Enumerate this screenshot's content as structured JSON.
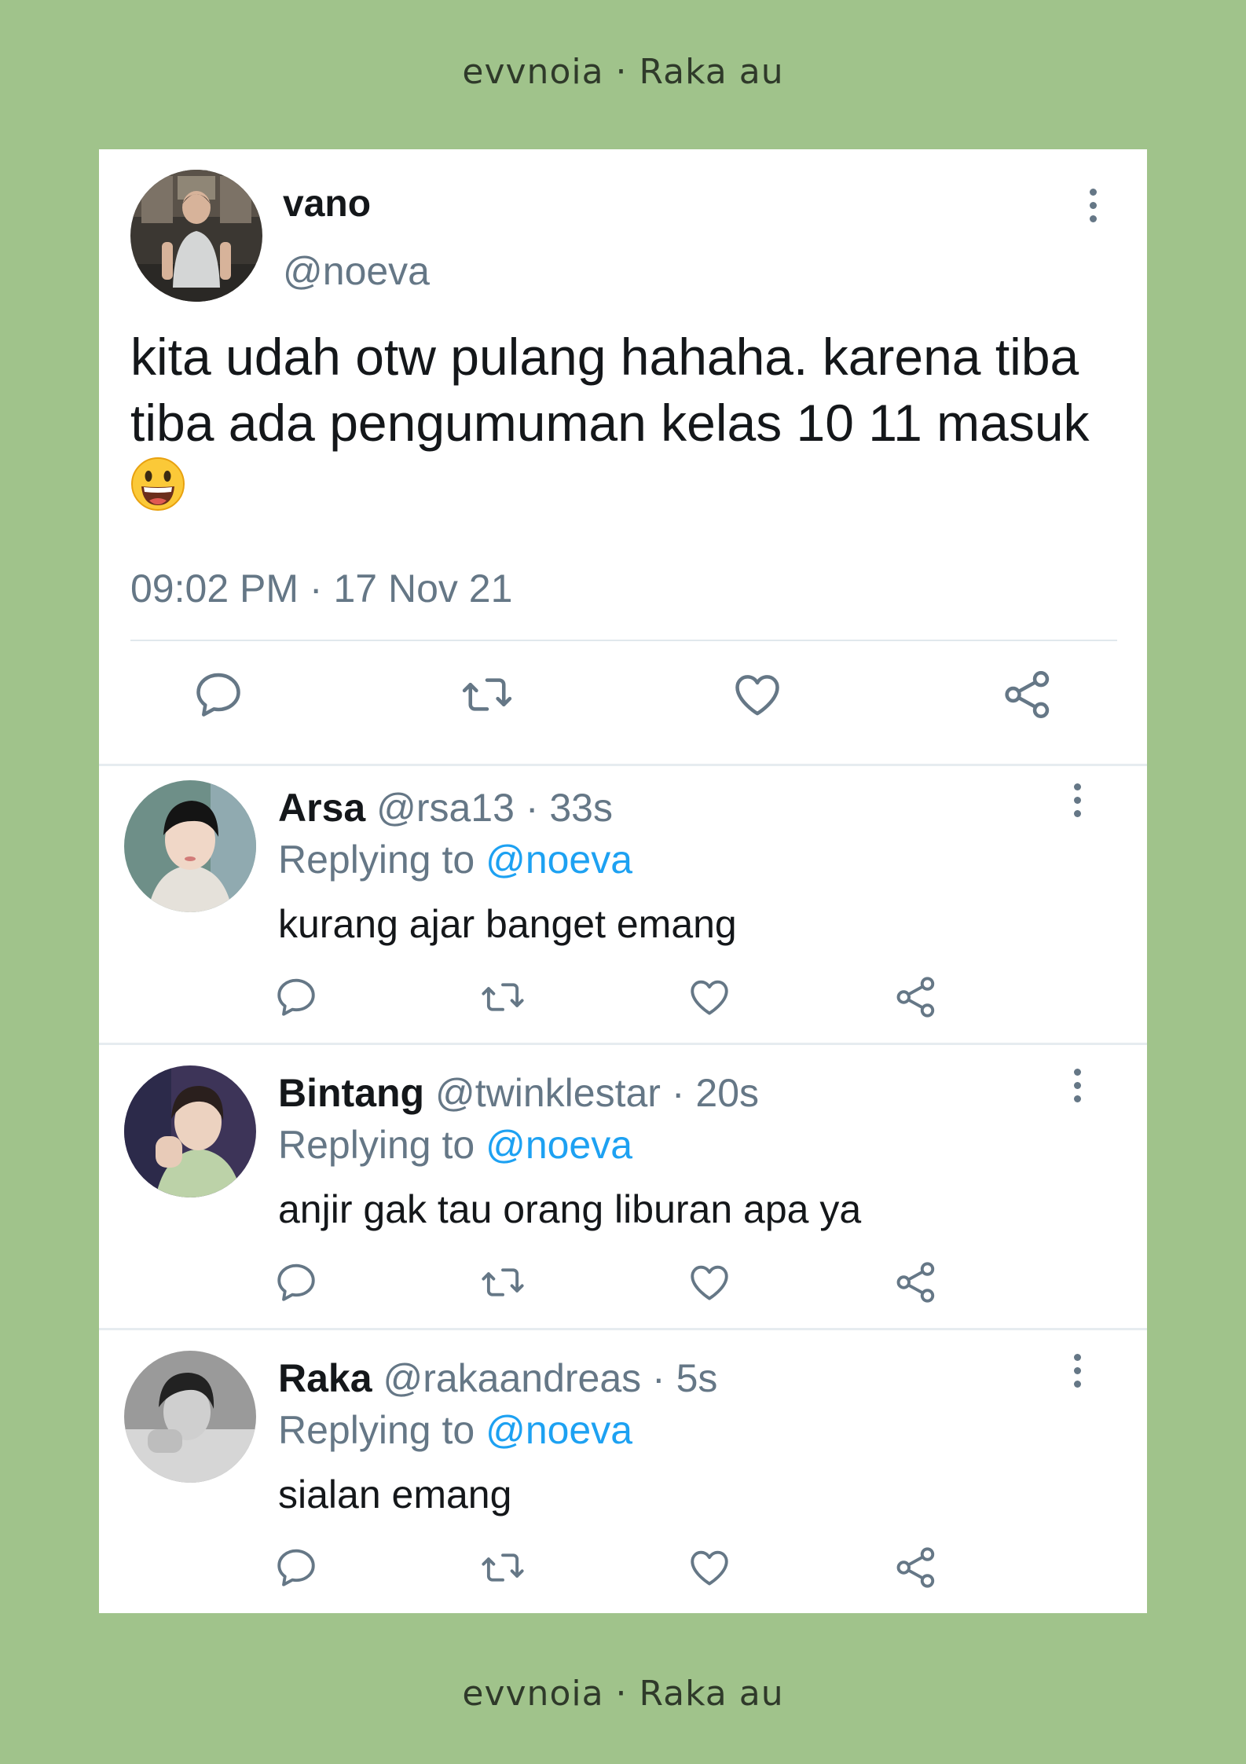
{
  "caption": {
    "top": "evvnoia · Raka au",
    "bottom": "evvnoia · Raka au"
  },
  "main_tweet": {
    "name": "vano",
    "handle": "@noeva",
    "text": "kita udah otw pulang hahaha. karena tiba tiba ada pengumuman kelas 10 11 masuk",
    "emoji": "😃",
    "timestamp": "09:02 PM · 17 Nov 21"
  },
  "replies": [
    {
      "name": "Arsa",
      "handle": "@rsa13",
      "time": "33s",
      "replying_label": "Replying to",
      "mention": "@noeva",
      "text": "kurang ajar banget emang"
    },
    {
      "name": "Bintang",
      "handle": "@twinklestar",
      "time": "20s",
      "replying_label": "Replying to",
      "mention": "@noeva",
      "text": "anjir gak tau orang liburan apa ya"
    },
    {
      "name": "Raka",
      "handle": "@rakaandreas",
      "time": "5s",
      "replying_label": "Replying to",
      "mention": "@noeva",
      "text": "sialan emang"
    }
  ],
  "icons": [
    "reply-icon",
    "retweet-icon",
    "like-icon",
    "share-icon",
    "more-icon"
  ],
  "colors": {
    "background": "#a0c38b",
    "mention": "#1da1f2",
    "muted": "#657786",
    "text": "#14171a"
  }
}
